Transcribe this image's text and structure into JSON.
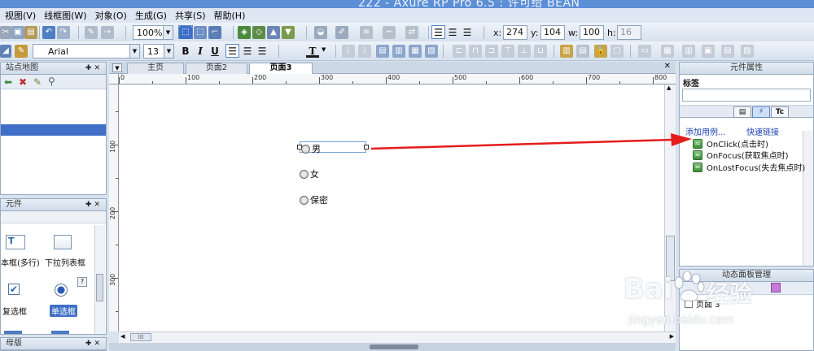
{
  "app": {
    "title": "222 - Axure RP Pro 6.5 : 许可给 BEAN"
  },
  "menu": [
    "视图(V)",
    "线框图(W)",
    "对象(O)",
    "生成(G)",
    "共享(S)",
    "帮助(H)"
  ],
  "toolbar": {
    "zoom": "100%",
    "font_family": "Arial",
    "font_size": "13",
    "bold": "B",
    "italic": "I",
    "underline": "U",
    "text_color": "T",
    "x_label": "x:",
    "x_value": "274",
    "y_label": "y:",
    "y_value": "104",
    "w_label": "w:",
    "w_value": "100",
    "h_label": "h:",
    "h_value": "16"
  },
  "sitemap_panel": {
    "title": "站点地图"
  },
  "widgets_panel": {
    "title": "元件",
    "items": [
      {
        "label": "本框(多行)",
        "icon": "multiline-textbox-icon"
      },
      {
        "label": "下拉列表框",
        "icon": "dropdown-list-icon"
      },
      {
        "label": "复选框",
        "icon": "checkbox-icon"
      },
      {
        "label": "单选框",
        "icon": "radio-button-icon"
      }
    ]
  },
  "masters_panel": {
    "title": "母版"
  },
  "page_tabs": [
    {
      "label": "主页",
      "active": false
    },
    {
      "label": "页面2",
      "active": false
    },
    {
      "label": "页面3",
      "active": true
    }
  ],
  "ruler": {
    "h_ticks": [
      "0",
      "100",
      "200",
      "300",
      "400",
      "500",
      "600",
      "700",
      "800"
    ],
    "v_ticks": [
      "100",
      "200",
      "300"
    ]
  },
  "canvas": {
    "radios": [
      {
        "label": "男",
        "selected": true
      },
      {
        "label": "女",
        "selected": false
      },
      {
        "label": "保密",
        "selected": false
      }
    ]
  },
  "widget_properties": {
    "title": "元件属性",
    "label_heading": "标签",
    "label_value": "",
    "tabs": [
      "annotations",
      "interactions",
      "style"
    ],
    "add_case": "添加用例...",
    "quick_link": "快速链接",
    "events": [
      "OnClick(点击时)",
      "OnFocus(获取焦点时)",
      "OnLostFocus(失去焦点时)"
    ]
  },
  "dynamic_panel_manager": {
    "title": "动态面板管理",
    "item": "页面 3"
  },
  "watermark": {
    "brand_latin": "Bai",
    "brand_cn": "经验",
    "url": "jingyan.baidu.com"
  },
  "colors": {
    "arrow": "#e51c1c",
    "link": "#1a3fb0",
    "selection": "#3f6fc7"
  }
}
